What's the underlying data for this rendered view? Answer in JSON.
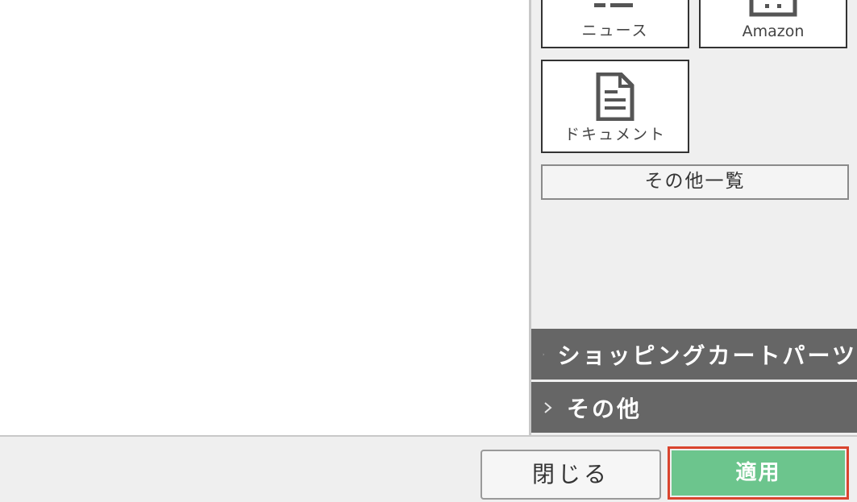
{
  "sidebar": {
    "tiles": [
      {
        "label": "ニュース",
        "icon": "news-icon"
      },
      {
        "label": "Amazon",
        "icon": "amazon-icon"
      },
      {
        "label": "ドキュメント",
        "icon": "document-icon"
      }
    ],
    "more_label": "その他一覧",
    "accordions": [
      {
        "label": "ショッピングカートパーツ",
        "icon": "chevron-right-icon"
      },
      {
        "label": "その他",
        "icon": "chevron-right-icon"
      }
    ]
  },
  "footer": {
    "close_label": "閉じる",
    "apply_label": "適用"
  },
  "colors": {
    "apply_bg": "#6cc58d",
    "apply_highlight": "#d9442e",
    "accordion_bg": "#666666",
    "sidebar_bg": "#efefef"
  }
}
